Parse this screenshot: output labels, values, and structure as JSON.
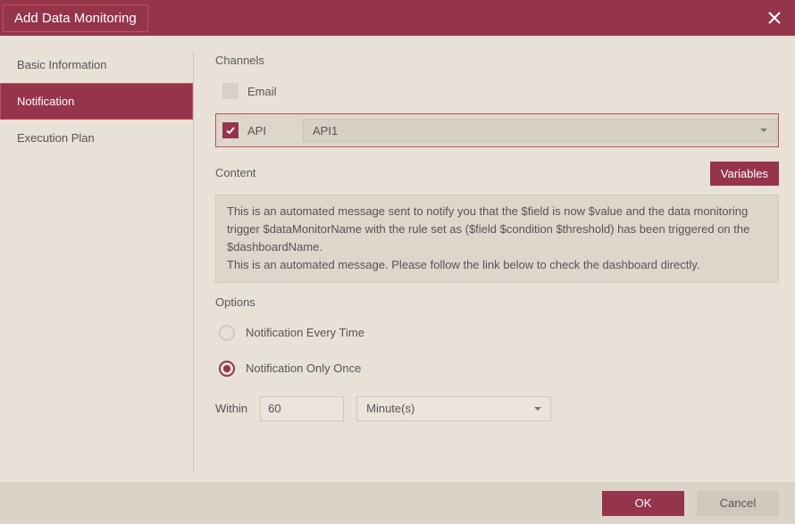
{
  "title": "Add Data Monitoring",
  "sidebar": {
    "items": [
      {
        "label": "Basic Information",
        "active": false
      },
      {
        "label": "Notification",
        "active": true
      },
      {
        "label": "Execution Plan",
        "active": false
      }
    ]
  },
  "channels": {
    "heading": "Channels",
    "email": {
      "label": "Email",
      "checked": false
    },
    "api": {
      "label": "API",
      "checked": true,
      "selected": "API1"
    }
  },
  "content_section": {
    "heading": "Content",
    "variables_button": "Variables",
    "body": "This is an automated message sent to notify you that the $field is now $value and the data monitoring trigger $dataMonitorName with the rule set as ($field $condition $threshold) has been triggered on the $dashboardName.\nThis is an automated message. Please follow the link below to check the dashboard directly."
  },
  "options": {
    "heading": "Options",
    "every_time": "Notification Every Time",
    "only_once": "Notification Only Once",
    "selected": "only_once",
    "within_label": "Within",
    "within_value": "60",
    "unit_selected": "Minute(s)"
  },
  "footer": {
    "ok": "OK",
    "cancel": "Cancel"
  }
}
